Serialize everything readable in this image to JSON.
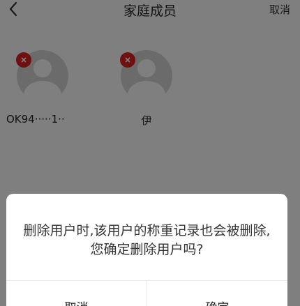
{
  "header": {
    "title": "家庭成员",
    "cancel_label": "取消"
  },
  "members": [
    {
      "name": "OK94·····1··"
    },
    {
      "name": "伊"
    }
  ],
  "dialog": {
    "message": "删除用户时,该用户的称重记录也会被删除,您确定删除用户吗?",
    "cancel_label": "取消",
    "confirm_label": "确定"
  }
}
